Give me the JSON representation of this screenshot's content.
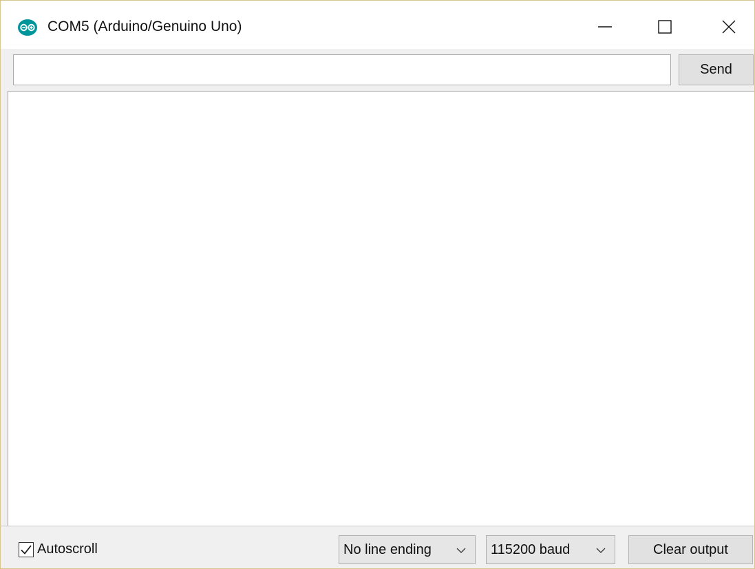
{
  "window": {
    "title": "COM5 (Arduino/Genuino Uno)",
    "icon": "arduino-logo-icon",
    "controls": [
      "minimize-icon",
      "maximize-icon",
      "close-icon"
    ],
    "accent_color": "#00979c"
  },
  "send_bar": {
    "input_value": "",
    "send_label": "Send"
  },
  "output": {
    "text": ""
  },
  "bottom_bar": {
    "autoscroll_label": "Autoscroll",
    "autoscroll_checked": true,
    "line_ending_selected": "No line ending",
    "baud_selected": "115200 baud",
    "clear_label": "Clear output"
  }
}
